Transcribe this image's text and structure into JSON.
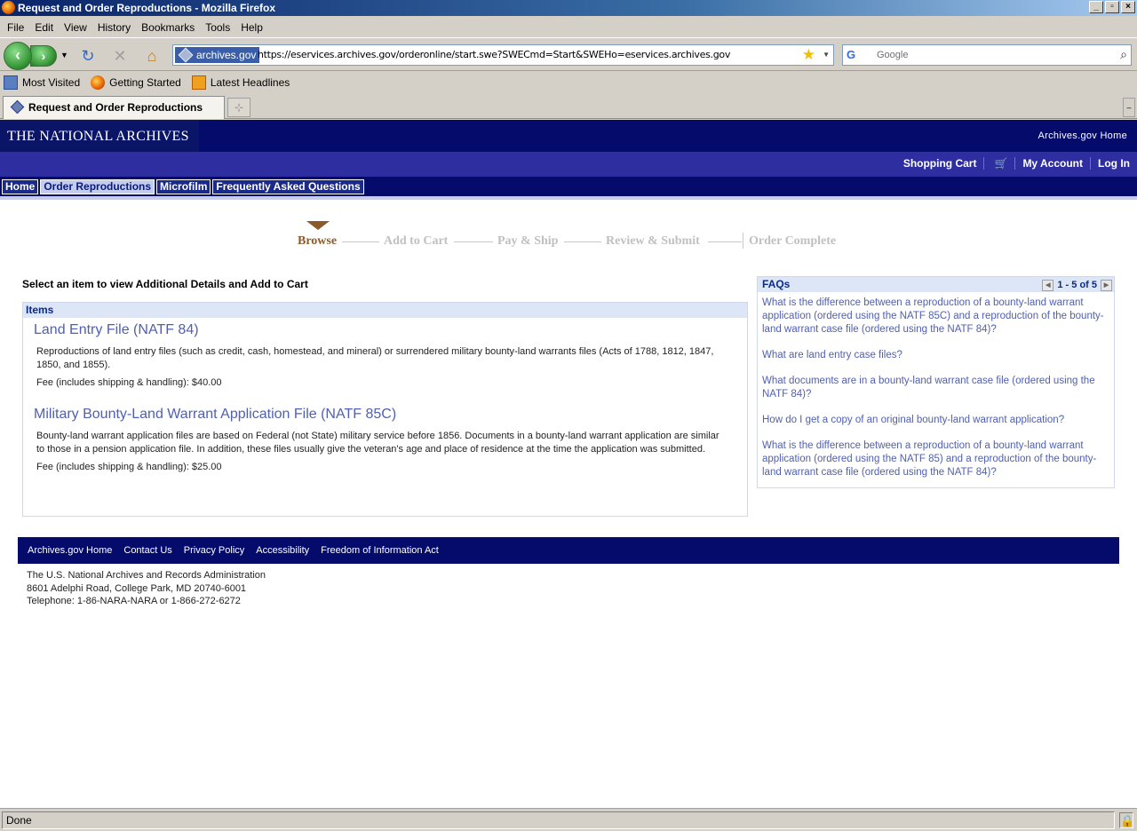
{
  "window": {
    "title": "Request and Order Reproductions - Mozilla Firefox",
    "controls": [
      "_",
      "▫",
      "×"
    ]
  },
  "menu": [
    "File",
    "Edit",
    "View",
    "History",
    "Bookmarks",
    "Tools",
    "Help"
  ],
  "toolbar": {
    "site_identity": "archives.gov",
    "url": "https://eservices.archives.gov/orderonline/start.swe?SWECmd=Start&SWEHo=eservices.archives.gov",
    "search_engine": "G",
    "search_placeholder": "Google"
  },
  "bookmarks": [
    "Most Visited",
    "Getting Started",
    "Latest Headlines"
  ],
  "tab": {
    "label": "Request and Order Reproductions",
    "newtab": "⊹"
  },
  "site": {
    "logo": "THE NATIONAL ARCHIVES",
    "home_link": "Archives.gov Home",
    "user_links": {
      "cart": "Shopping Cart",
      "account": "My Account",
      "login": "Log In"
    },
    "nav": [
      "Home",
      "Order Reproductions",
      "Microfilm",
      "Frequently Asked Questions"
    ],
    "nav_active_index": 1
  },
  "steps": [
    "Browse",
    "Add to Cart",
    "Pay & Ship",
    "Review & Submit",
    "Order Complete"
  ],
  "main": {
    "heading": "Select an item to view Additional Details and Add to Cart",
    "items_header": "Items",
    "items": [
      {
        "title": "Land Entry File (NATF 84)",
        "desc": "Reproductions of land entry files (such as credit, cash, homestead, and mineral) or surrendered military bounty-land warrants files (Acts of 1788, 1812, 1847, 1850, and 1855).",
        "fee": "Fee (includes shipping & handling): $40.00"
      },
      {
        "title": "Military Bounty-Land Warrant Application File (NATF 85C)",
        "desc": "Bounty-land warrant application files are based on Federal (not State) military service before 1856. Documents in a bounty-land warrant application are similar to those in a pension application file. In addition, these files usually give the veteran's age and place of residence at the time the application was submitted.",
        "fee": "Fee (includes shipping & handling): $25.00"
      }
    ]
  },
  "faq": {
    "header": "FAQs",
    "pager": "1 - 5 of 5",
    "items": [
      "What is the difference between a reproduction of a bounty-land warrant application (ordered using the NATF 85C) and a reproduction of the bounty-land warrant case file (ordered using the NATF 84)?",
      "What are land entry case files?",
      "What documents are in a bounty-land warrant case file (ordered using the NATF 84)?",
      "How do I get a copy of an original bounty-land warrant application?",
      "What is the difference between a reproduction of a bounty-land warrant application (ordered using the NATF 85) and a reproduction of the bounty-land warrant case file (ordered using the NATF 84)?"
    ]
  },
  "footer": {
    "links": [
      "Archives.gov Home",
      "Contact Us",
      "Privacy Policy",
      "Accessibility",
      "Freedom of Information Act"
    ],
    "address": [
      "The U.S. National Archives and Records Administration",
      "8601 Adelphi Road, College Park, MD 20740-6001",
      "Telephone: 1-86-NARA-NARA or 1-866-272-6272"
    ]
  },
  "status": "Done",
  "colors": {
    "navy": "#040b6b",
    "user_bar": "#2f2ea0",
    "link": "#5060b0",
    "step_active": "#8a5a2a"
  }
}
